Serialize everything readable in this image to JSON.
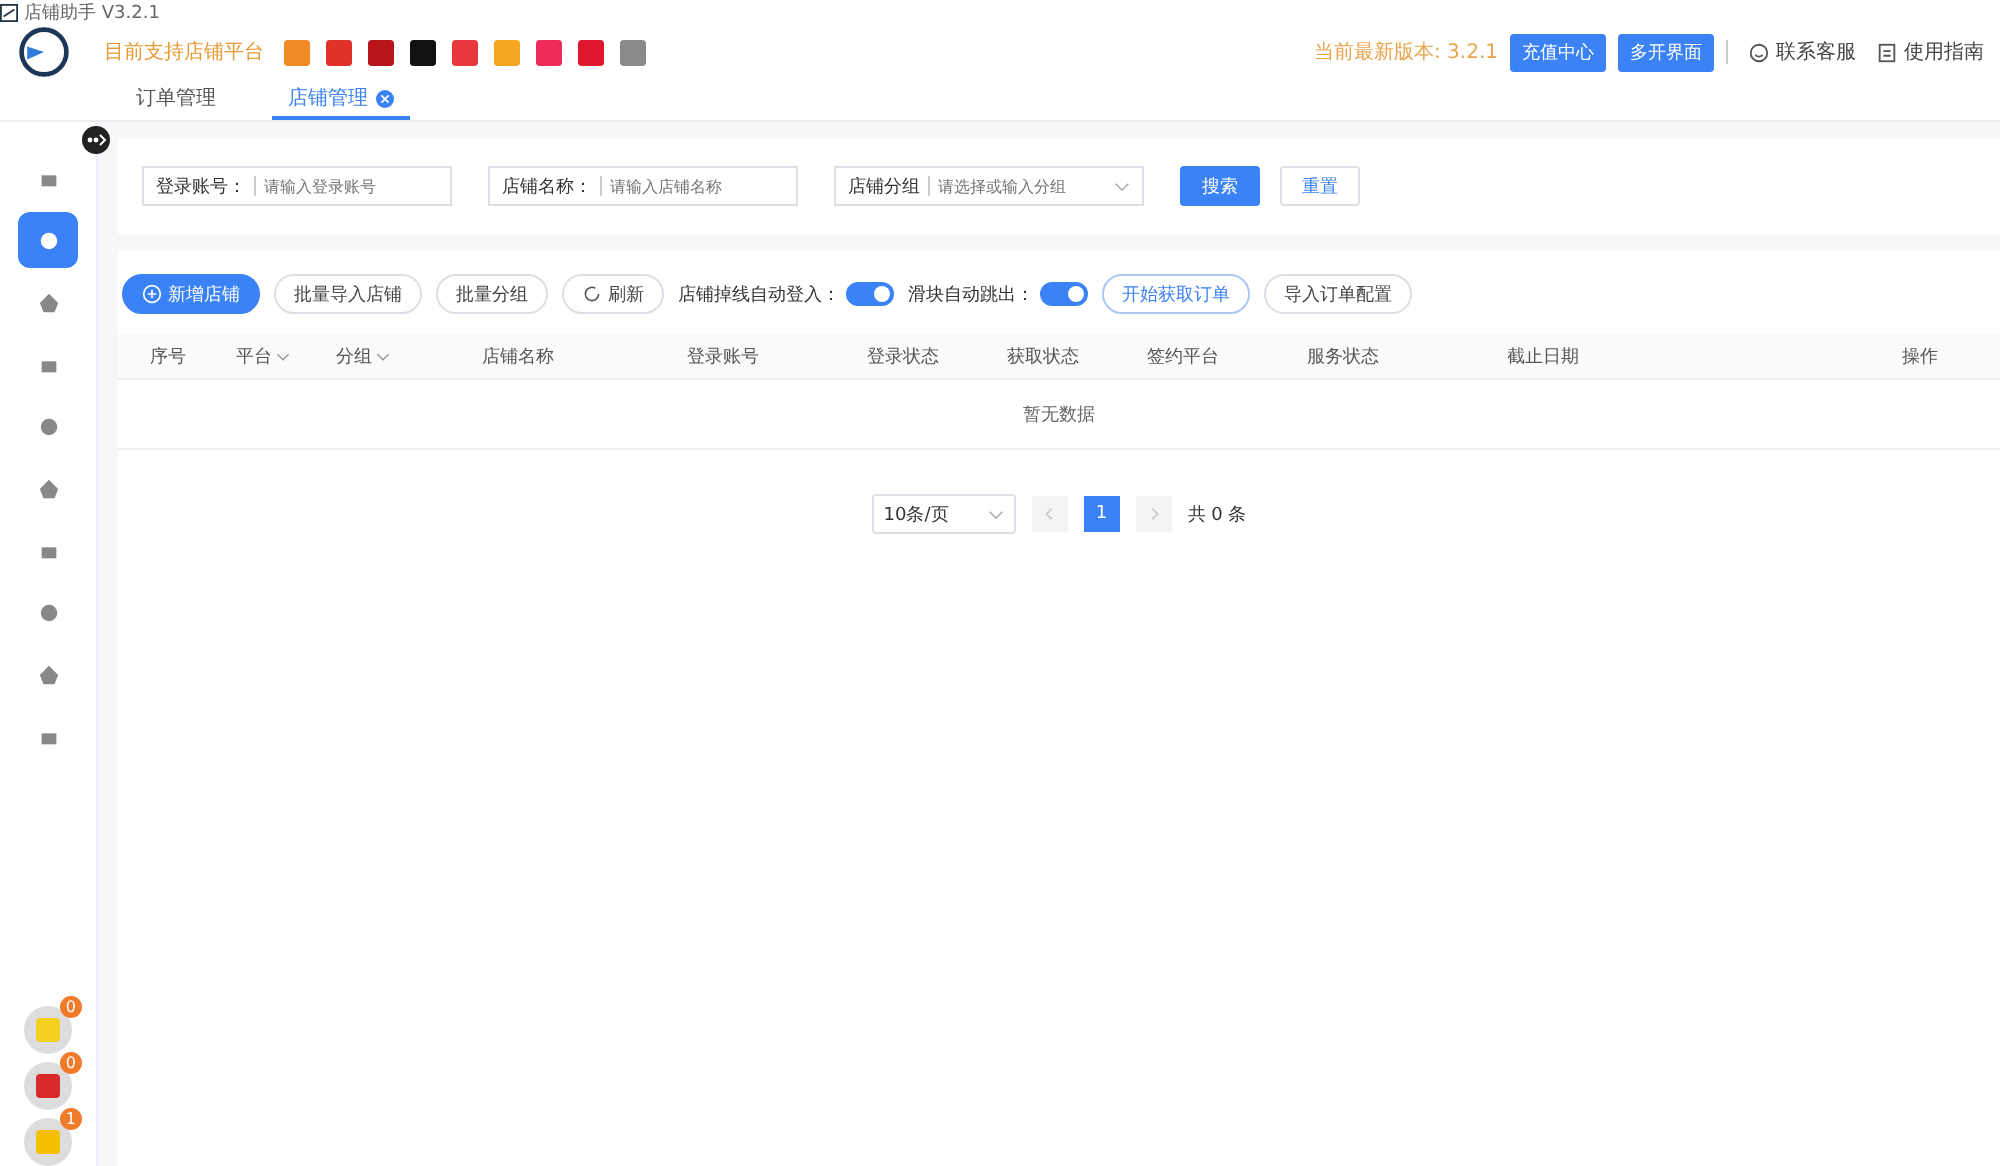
{
  "window": {
    "title": "店铺助手 V3.2.1"
  },
  "header": {
    "platforms_label": "目前支持店铺平台",
    "platforms": [
      {
        "color": "#f08a24"
      },
      {
        "color": "#e0312b"
      },
      {
        "color": "#b8141b"
      },
      {
        "color": "#111111"
      },
      {
        "color": "#e8383d"
      },
      {
        "color": "#f5a623"
      },
      {
        "color": "#ee2a5a"
      },
      {
        "color": "#e0182d"
      },
      {
        "color": "#8a8a8a"
      }
    ],
    "version": "当前最新版本: 3.2.1",
    "buttons": [
      "充值中心",
      "多开界面"
    ],
    "links": [
      "联系客服",
      "使用指南"
    ]
  },
  "tabs": [
    {
      "label": "订单管理",
      "selected": false,
      "closable": false
    },
    {
      "label": "店铺管理",
      "selected": true,
      "closable": true
    }
  ],
  "sidebar": {
    "items": [
      {
        "selected": false
      },
      {
        "selected": true
      },
      {
        "selected": false
      },
      {
        "selected": false
      },
      {
        "selected": false
      },
      {
        "selected": false
      },
      {
        "selected": false
      },
      {
        "selected": false
      },
      {
        "selected": false
      },
      {
        "selected": false
      }
    ],
    "floating": [
      {
        "badge": "0",
        "color": "#f5d020"
      },
      {
        "badge": "0",
        "color": "#d92b2b"
      },
      {
        "badge": "1",
        "color": "#f5c000"
      }
    ]
  },
  "filters": [
    {
      "kind": "input",
      "label": "登录账号：",
      "placeholder": "请输入登录账号"
    },
    {
      "kind": "input",
      "label": "店铺名称：",
      "placeholder": "请输入店铺名称"
    },
    {
      "kind": "select",
      "label": "店铺分组",
      "placeholder": "请选择或输入分组"
    }
  ],
  "filter_buttons": [
    {
      "label": "搜索",
      "primary": true
    },
    {
      "label": "重置",
      "primary": false
    }
  ],
  "toolbar": [
    {
      "kind": "button",
      "label": "新增店铺",
      "primary": true
    },
    {
      "kind": "button",
      "label": "批量导入店铺",
      "primary": false
    },
    {
      "kind": "button",
      "label": "批量分组",
      "primary": false
    },
    {
      "kind": "button",
      "label": "刷新",
      "primary": false
    },
    {
      "kind": "toggle",
      "label": "店铺掉线自动登入：",
      "on": true
    },
    {
      "kind": "toggle",
      "label": "滑块自动跳出：",
      "on": true
    },
    {
      "kind": "button",
      "label": "开始获取订单",
      "primary": false,
      "outline": true
    },
    {
      "kind": "button",
      "label": "导入订单配置",
      "primary": false
    }
  ],
  "table": {
    "columns": [
      {
        "label": "序号",
        "sortable": false
      },
      {
        "label": "平台",
        "sortable": true
      },
      {
        "label": "分组",
        "sortable": true
      },
      {
        "label": "店铺名称",
        "sortable": false
      },
      {
        "label": "登录账号",
        "sortable": false
      },
      {
        "label": "登录状态",
        "sortable": false
      },
      {
        "label": "获取状态",
        "sortable": false
      },
      {
        "label": "签约平台",
        "sortable": false
      },
      {
        "label": "服务状态",
        "sortable": false
      },
      {
        "label": "截止日期",
        "sortable": false
      },
      {
        "label": "操作",
        "sortable": false
      }
    ],
    "empty": "暂无数据"
  },
  "pagination": {
    "page_size": "10条/页",
    "pages": [
      {
        "label": "1",
        "selected": true
      }
    ],
    "total": "共 0 条"
  }
}
